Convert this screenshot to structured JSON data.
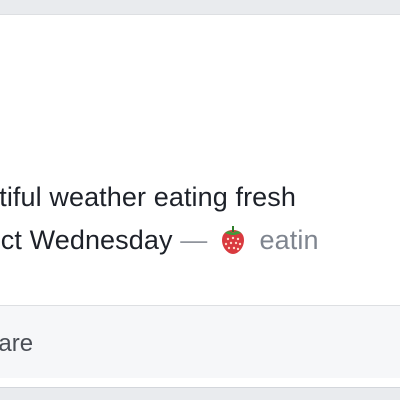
{
  "post": {
    "line1": "autiful weather eating fresh",
    "line2_prefix": "rfect Wednesday",
    "separator": "—",
    "activity_emoji_icon": "strawberry-icon",
    "activity_text": "eatin"
  },
  "actions": {
    "share_label": "hare"
  },
  "colors": {
    "page_background": "#e9ebee",
    "card_background": "#ffffff",
    "text": "#1d2129",
    "muted_text": "#90949c",
    "action_bar_background": "#f6f7f9"
  }
}
